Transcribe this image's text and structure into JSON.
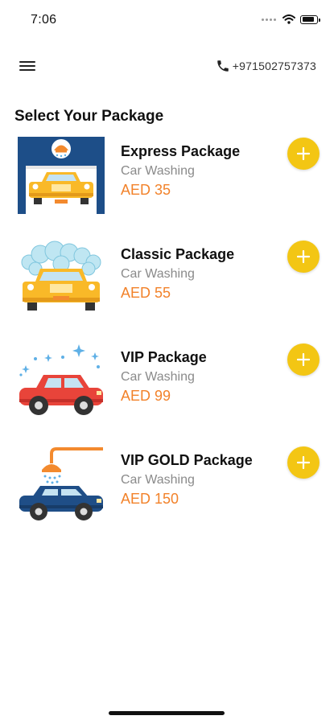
{
  "status_bar": {
    "time": "7:06",
    "battery_level": 0.9
  },
  "header": {
    "menu_icon": "hamburger-menu-icon",
    "phone_icon": "phone-icon",
    "phone_number": "+971502757373"
  },
  "page_title": "Select Your Package",
  "packages": [
    {
      "name": "Express Package",
      "category": "Car Washing",
      "price": "AED 35",
      "image": "car-wash-garage-icon"
    },
    {
      "name": "Classic Package",
      "category": "Car Washing",
      "price": "AED 55",
      "image": "foam-wash-car-icon"
    },
    {
      "name": "VIP Package",
      "category": "Car Washing",
      "price": "AED 99",
      "image": "sparkling-car-icon"
    },
    {
      "name": "VIP GOLD Package",
      "category": "Car Washing",
      "price": "AED 150",
      "image": "shower-car-icon"
    }
  ],
  "colors": {
    "accent_yellow": "#f3c614",
    "price_orange": "#f2822a",
    "subtitle_gray": "#8a8a8a"
  }
}
